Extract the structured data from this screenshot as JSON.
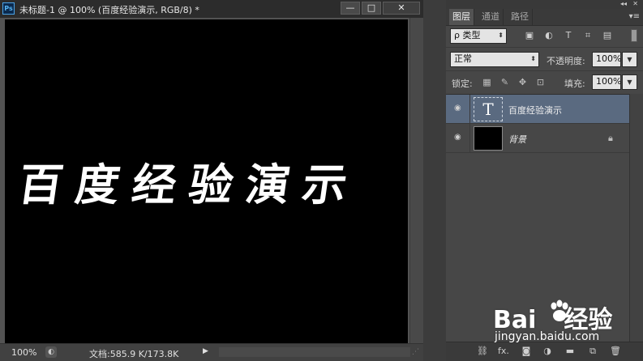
{
  "document": {
    "app_icon": "Ps",
    "title": "未标题-1 @ 100% (百度经验演示, RGB/8) *",
    "window_buttons": {
      "minimize": "—",
      "maximize": "□",
      "close": "✕"
    },
    "canvas_text": "百度经验演示",
    "status": {
      "zoom": "100%",
      "doc_info": "文档:585.9 K/173.8K",
      "arrow": "▶"
    }
  },
  "panel": {
    "topbar": {
      "collapse": "◂◂",
      "close": "✕"
    },
    "tabs": [
      {
        "label": "图层",
        "active": true
      },
      {
        "label": "通道",
        "active": false
      },
      {
        "label": "路径",
        "active": false
      }
    ],
    "menu_icon": "▾≡",
    "filter": {
      "kind_label": "ρ 类型",
      "icons": [
        "image-filter-icon",
        "adjustment-filter-icon",
        "type-filter-icon",
        "shape-filter-icon",
        "smart-object-filter-icon"
      ]
    },
    "blend_mode": "正常",
    "opacity_label": "不透明度:",
    "opacity_value": "100%",
    "lock_label": "锁定:",
    "lock_icons": [
      "lock-transparent-icon",
      "lock-image-icon",
      "lock-position-icon",
      "lock-all-icon"
    ],
    "fill_label": "填充:",
    "fill_value": "100%",
    "layers": [
      {
        "name": "百度经验演示",
        "thumb": "T",
        "selected": true,
        "visible": true
      },
      {
        "name": "背景",
        "selected": false,
        "visible": true,
        "locked": true
      }
    ],
    "footer_icons": [
      "link-icon",
      "fx-icon",
      "mask-icon",
      "adjustment-icon",
      "group-icon",
      "new-layer-icon",
      "trash-icon"
    ],
    "footer_fx_label": "fx."
  },
  "watermark": {
    "logo_left": "Bai",
    "logo_right": "经验",
    "url": "jingyan.baidu.com"
  }
}
